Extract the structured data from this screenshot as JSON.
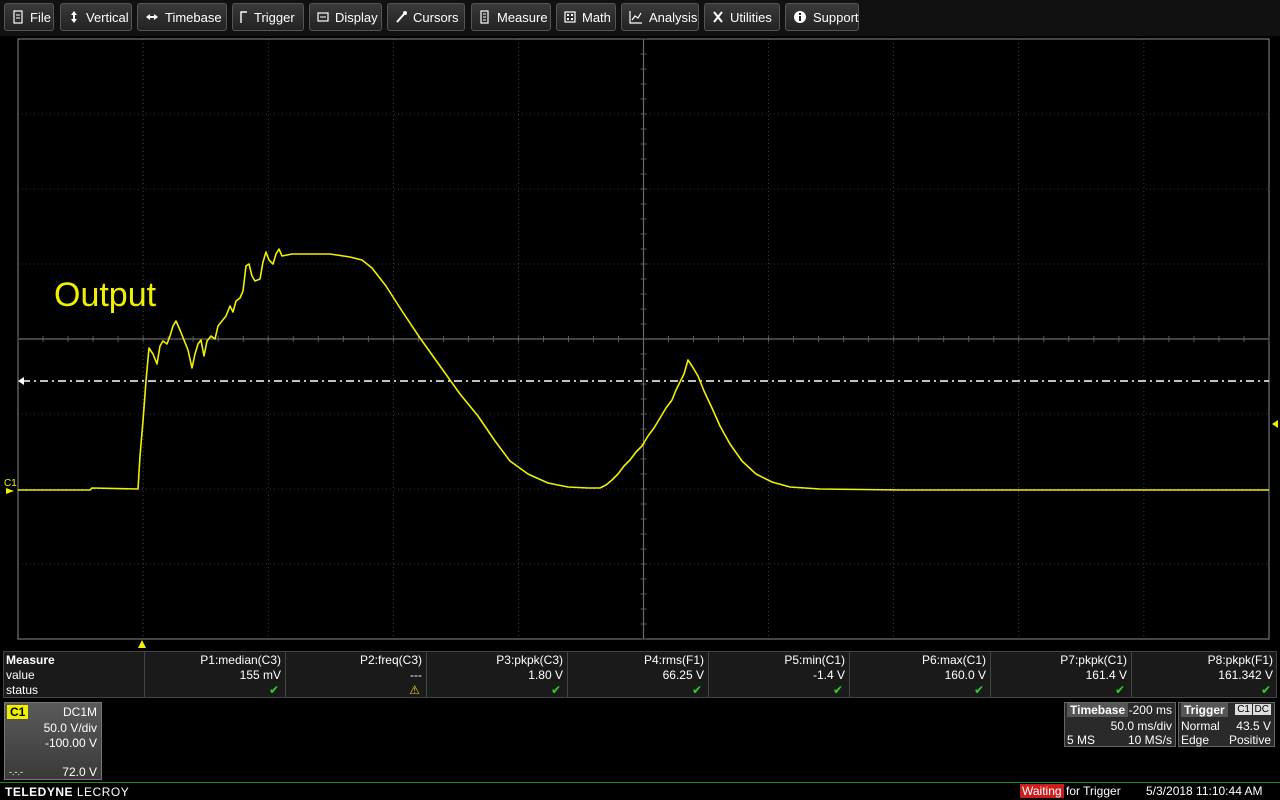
{
  "menu": {
    "file": "File",
    "vertical": "Vertical",
    "timebase": "Timebase",
    "trigger": "Trigger",
    "display": "Display",
    "cursors": "Cursors",
    "measure": "Measure",
    "math": "Math",
    "analysis": "Analysis",
    "utilities": "Utilities",
    "support": "Support"
  },
  "screen": {
    "trace_label": "Output",
    "channel_marker": "C1",
    "trace_color": "#f0f000",
    "grid_color": "#6a6a6a"
  },
  "measure": {
    "title": "Measure",
    "row_value": "value",
    "row_status": "status",
    "params": [
      {
        "name": "P1:median(C3)",
        "value": "155 mV",
        "status": "ok"
      },
      {
        "name": "P2:freq(C3)",
        "value": "---",
        "status": "warn"
      },
      {
        "name": "P3:pkpk(C3)",
        "value": "1.80 V",
        "status": "ok"
      },
      {
        "name": "P4:rms(F1)",
        "value": "66.25 V",
        "status": "ok"
      },
      {
        "name": "P5:min(C1)",
        "value": "-1.4 V",
        "status": "ok"
      },
      {
        "name": "P6:max(C1)",
        "value": "160.0 V",
        "status": "ok"
      },
      {
        "name": "P7:pkpk(C1)",
        "value": "161.4 V",
        "status": "ok"
      },
      {
        "name": "P8:pkpk(F1)",
        "value": "161.342 V",
        "status": "ok"
      }
    ],
    "ok_glyph": "✔",
    "warn_glyph": "⚠"
  },
  "channel": {
    "tag": "C1",
    "coupling": "DC1M",
    "vdiv": "50.0 V/div",
    "offset": "-100.00 V",
    "marker": "-.-.-",
    "level": "72.0 V"
  },
  "timebase": {
    "title": "Timebase",
    "delay": "-200 ms",
    "tdiv": "50.0 ms/div",
    "samples": "5 MS",
    "rate": "10 MS/s"
  },
  "trigger": {
    "title": "Trigger",
    "src": "C1",
    "coupling": "DC",
    "mode": "Normal",
    "level": "43.5 V",
    "type": "Edge",
    "slope": "Positive"
  },
  "status": {
    "brand_bold": "TELEDYNE",
    "brand_lite": "LECROY",
    "waiting": "Waiting",
    "for_trigger": "for Trigger",
    "datetime": "5/3/2018 11:10:44 AM"
  }
}
